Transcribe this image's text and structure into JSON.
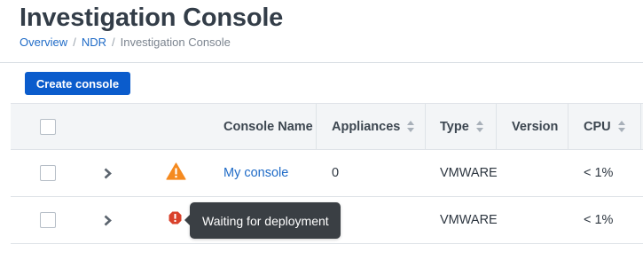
{
  "page": {
    "title": "Investigation Console",
    "breadcrumb": [
      {
        "label": "Overview"
      },
      {
        "label": "NDR"
      },
      {
        "label": "Investigation Console"
      }
    ],
    "breadcrumb_separator": "/"
  },
  "toolbar": {
    "create_label": "Create console"
  },
  "table": {
    "columns": {
      "name": "Console Name",
      "appliances": "Appliances",
      "type": "Type",
      "version": "Version",
      "cpu": "CPU"
    },
    "rows": [
      {
        "status_icon": "warning-triangle-icon",
        "name": "My console",
        "appliances": "0",
        "type": "VMWARE",
        "version": "",
        "cpu": "< 1%"
      },
      {
        "status_icon": "error-octagon-icon",
        "name": "",
        "appliances": "",
        "type": "VMWARE",
        "version": "",
        "cpu": "< 1%"
      }
    ]
  },
  "tooltip": {
    "text": "Waiting for deployment"
  },
  "colors": {
    "primary": "#0b5ccc",
    "link": "#1f6bc7",
    "warning": "#f58a1f",
    "error": "#d9412b",
    "tooltip_bg": "#3a3f44"
  }
}
